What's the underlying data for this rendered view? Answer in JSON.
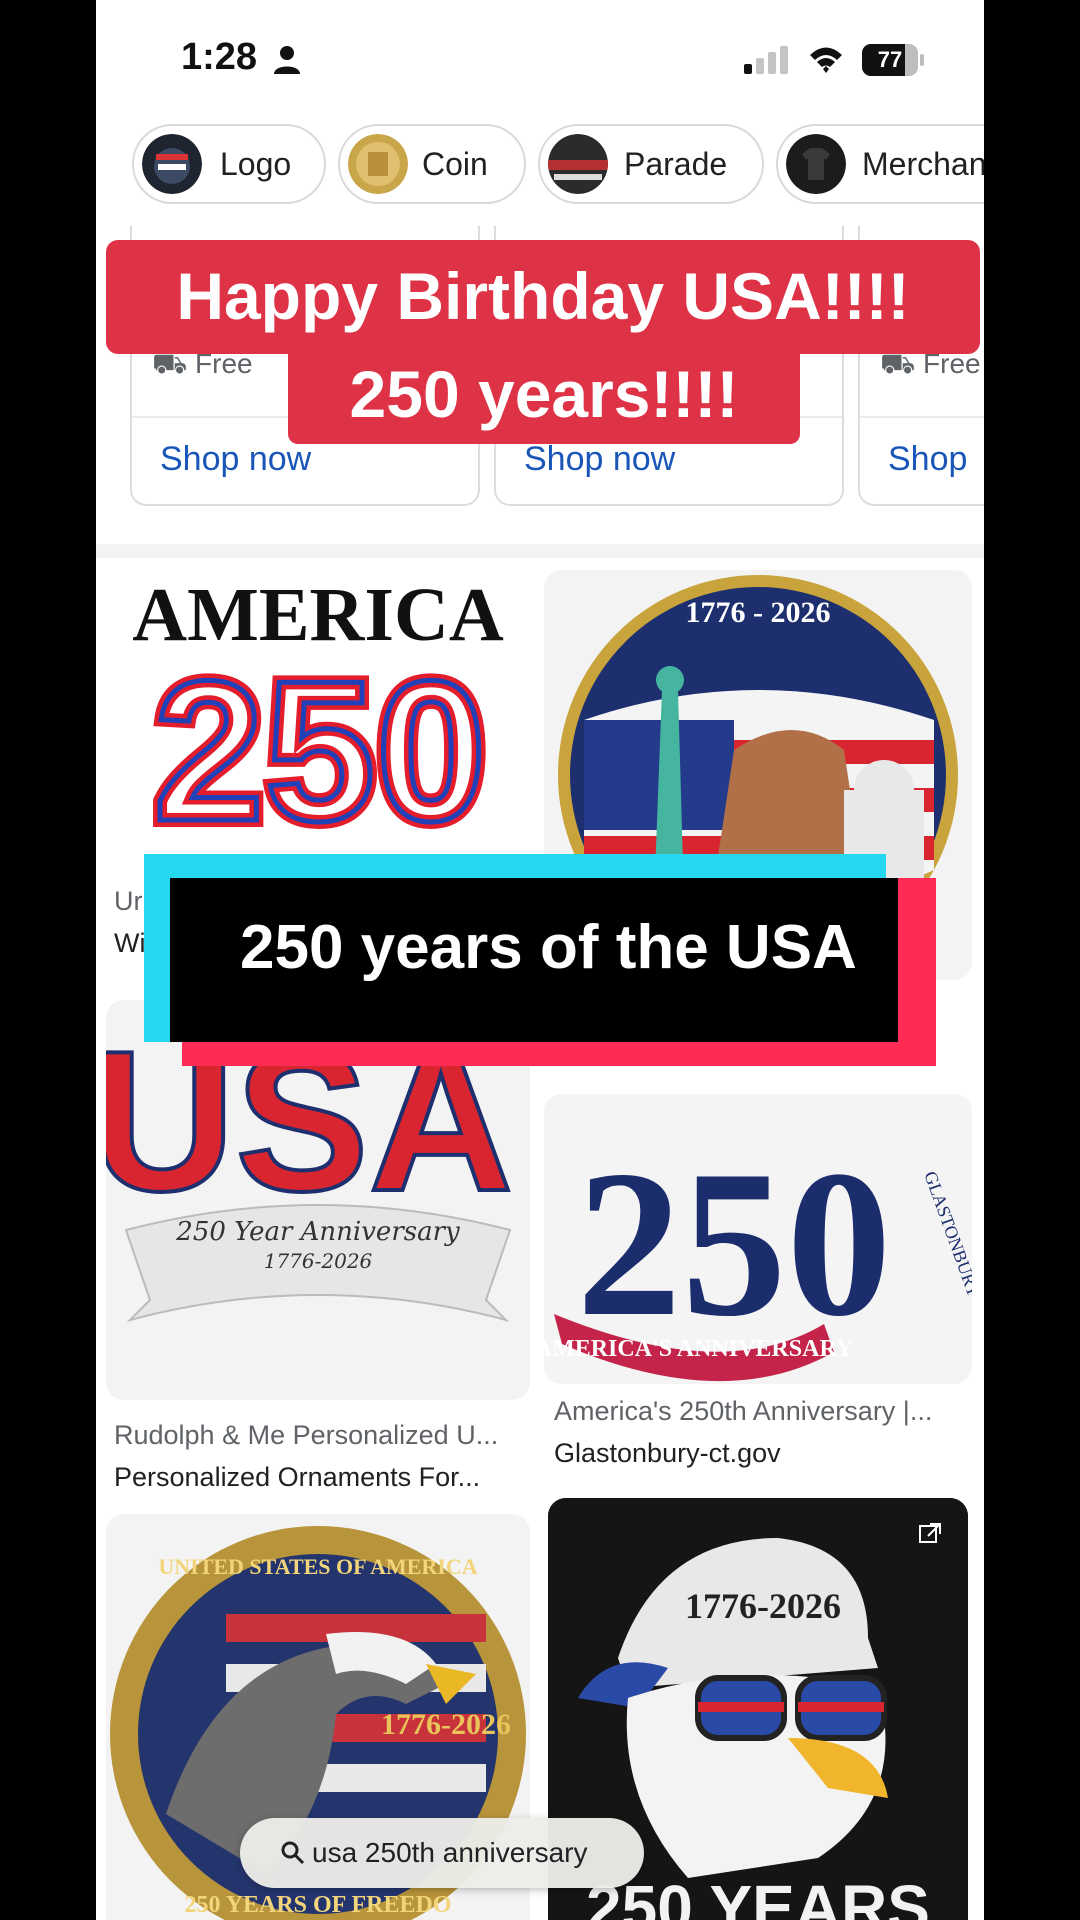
{
  "status_bar": {
    "time": "1:28",
    "battery": "77"
  },
  "chips": [
    {
      "label": "Logo"
    },
    {
      "label": "Coin"
    },
    {
      "label": "Parade"
    },
    {
      "label": "Merchan"
    }
  ],
  "shopping": {
    "cards": [
      {
        "shipping": "Free",
        "link": "Shop now"
      },
      {
        "shipping": "",
        "link": "Shop now"
      },
      {
        "shipping": "Free",
        "link": "Shop"
      }
    ]
  },
  "results": [
    {
      "image_text_top": "AMERICA",
      "image_text_big": "250",
      "source": "Ur",
      "title": "Wi"
    },
    {
      "image_text_top": "1776 - 2026"
    },
    {
      "image_text_top": "USA",
      "image_text_mid": "250 Year Anniversary",
      "image_text_sub": "1776-2026",
      "source": "Rudolph & Me Personalized U...",
      "title": "Personalized Ornaments For..."
    },
    {
      "image_text_big": "250",
      "image_text_side": "GLASTONBURY",
      "image_text_banner": "AMERICA'S ANNIVERSARY",
      "source": "America's 250th Anniversary |...",
      "title": "Glastonbury-ct.gov"
    },
    {
      "image_text_top": "UNITED STATES OF AMERICA",
      "image_text_mid": "1776-2026",
      "image_text_bottom": "250 YEARS OF FREEDO"
    },
    {
      "image_text_cap": "1776-2026",
      "image_text_bottom": "250 YEARS"
    }
  ],
  "overlays": {
    "banner_line1": "Happy Birthday USA!!!!",
    "banner_line2": "250 years!!!!",
    "caption": "250 years of the USA"
  },
  "search": {
    "query": "usa 250th anniversary"
  },
  "colors": {
    "red_overlay": "#de3346",
    "tiktok_cyan": "#25d7ef",
    "tiktok_pink": "#fe2c55",
    "link_blue": "#1a56b8",
    "navy": "#1c2d6e"
  }
}
